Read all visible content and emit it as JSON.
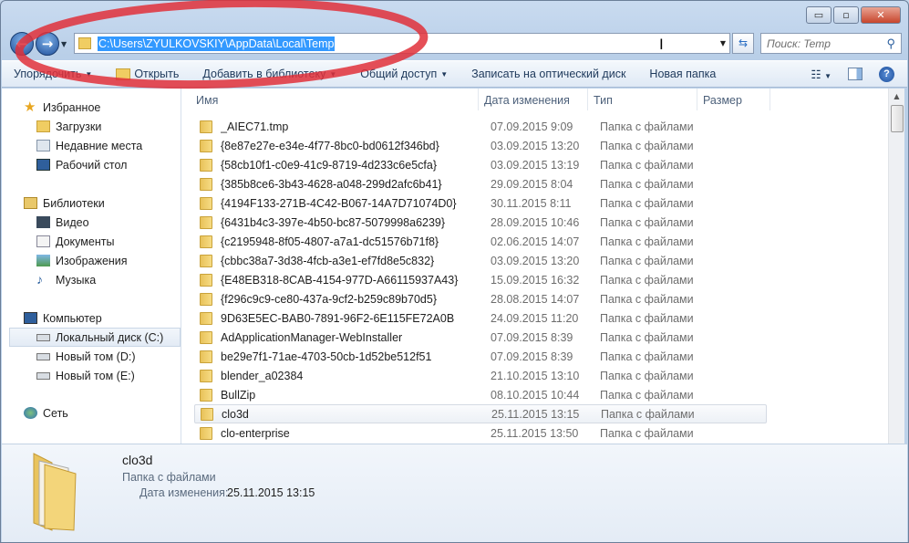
{
  "window": {
    "minimize": "▭",
    "maximize": "▫",
    "close": "✕"
  },
  "address": {
    "path": "C:\\Users\\ZYULKOVSKIY\\AppData\\Local\\Temp"
  },
  "search": {
    "placeholder": "Поиск: Temp"
  },
  "toolbar": {
    "organize": "Упорядочить",
    "open": "Открыть",
    "add_library": "Добавить в библиотеку",
    "share": "Общий доступ",
    "burn": "Записать на оптический диск",
    "new_folder": "Новая папка"
  },
  "sidebar": {
    "favorites": "Избранное",
    "downloads": "Загрузки",
    "recent": "Недавние места",
    "desktop": "Рабочий стол",
    "libraries": "Библиотеки",
    "video": "Видео",
    "documents": "Документы",
    "images": "Изображения",
    "music": "Музыка",
    "computer": "Компьютер",
    "disk_c": "Локальный диск (C:)",
    "disk_d": "Новый том (D:)",
    "disk_e": "Новый том (E:)",
    "network": "Сеть"
  },
  "columns": {
    "name": "Имя",
    "date": "Дата изменения",
    "type": "Тип",
    "size": "Размер"
  },
  "files": [
    {
      "name": "_AIEC71.tmp",
      "date": "07.09.2015 9:09",
      "type": "Папка с файлами"
    },
    {
      "name": "{8e87e27e-e34e-4f77-8bc0-bd0612f346bd}",
      "date": "03.09.2015 13:20",
      "type": "Папка с файлами"
    },
    {
      "name": "{58cb10f1-c0e9-41c9-8719-4d233c6e5cfa}",
      "date": "03.09.2015 13:19",
      "type": "Папка с файлами"
    },
    {
      "name": "{385b8ce6-3b43-4628-a048-299d2afc6b41}",
      "date": "29.09.2015 8:04",
      "type": "Папка с файлами"
    },
    {
      "name": "{4194F133-271B-4C42-B067-14A7D71074D0}",
      "date": "30.11.2015 8:11",
      "type": "Папка с файлами"
    },
    {
      "name": "{6431b4c3-397e-4b50-bc87-5079998a6239}",
      "date": "28.09.2015 10:46",
      "type": "Папка с файлами"
    },
    {
      "name": "{c2195948-8f05-4807-a7a1-dc51576b71f8}",
      "date": "02.06.2015 14:07",
      "type": "Папка с файлами"
    },
    {
      "name": "{cbbc38a7-3d38-4fcb-a3e1-ef7fd8e5c832}",
      "date": "03.09.2015 13:20",
      "type": "Папка с файлами"
    },
    {
      "name": "{E48EB318-8CAB-4154-977D-A66115937A43}",
      "date": "15.09.2015 16:32",
      "type": "Папка с файлами"
    },
    {
      "name": "{f296c9c9-ce80-437a-9cf2-b259c89b70d5}",
      "date": "28.08.2015 14:07",
      "type": "Папка с файлами"
    },
    {
      "name": "9D63E5EC-BAB0-7891-96F2-6E115FE72A0B",
      "date": "24.09.2015 11:20",
      "type": "Папка с файлами"
    },
    {
      "name": "AdApplicationManager-WebInstaller",
      "date": "07.09.2015 8:39",
      "type": "Папка с файлами"
    },
    {
      "name": "be29e7f1-71ae-4703-50cb-1d52be512f51",
      "date": "07.09.2015 8:39",
      "type": "Папка с файлами"
    },
    {
      "name": "blender_a02384",
      "date": "21.10.2015 13:10",
      "type": "Папка с файлами"
    },
    {
      "name": "BullZip",
      "date": "08.10.2015 10:44",
      "type": "Папка с файлами"
    },
    {
      "name": "clo3d",
      "date": "25.11.2015 13:15",
      "type": "Папка с файлами",
      "selected": true
    },
    {
      "name": "clo-enterprise",
      "date": "25.11.2015 13:50",
      "type": "Папка с файлами"
    }
  ],
  "details": {
    "name": "clo3d",
    "type": "Папка с файлами",
    "date_label": "Дата изменения:",
    "date_value": "25.11.2015 13:15"
  },
  "colors": {
    "selection": "#3399ff",
    "annotation": "#e0303a"
  }
}
